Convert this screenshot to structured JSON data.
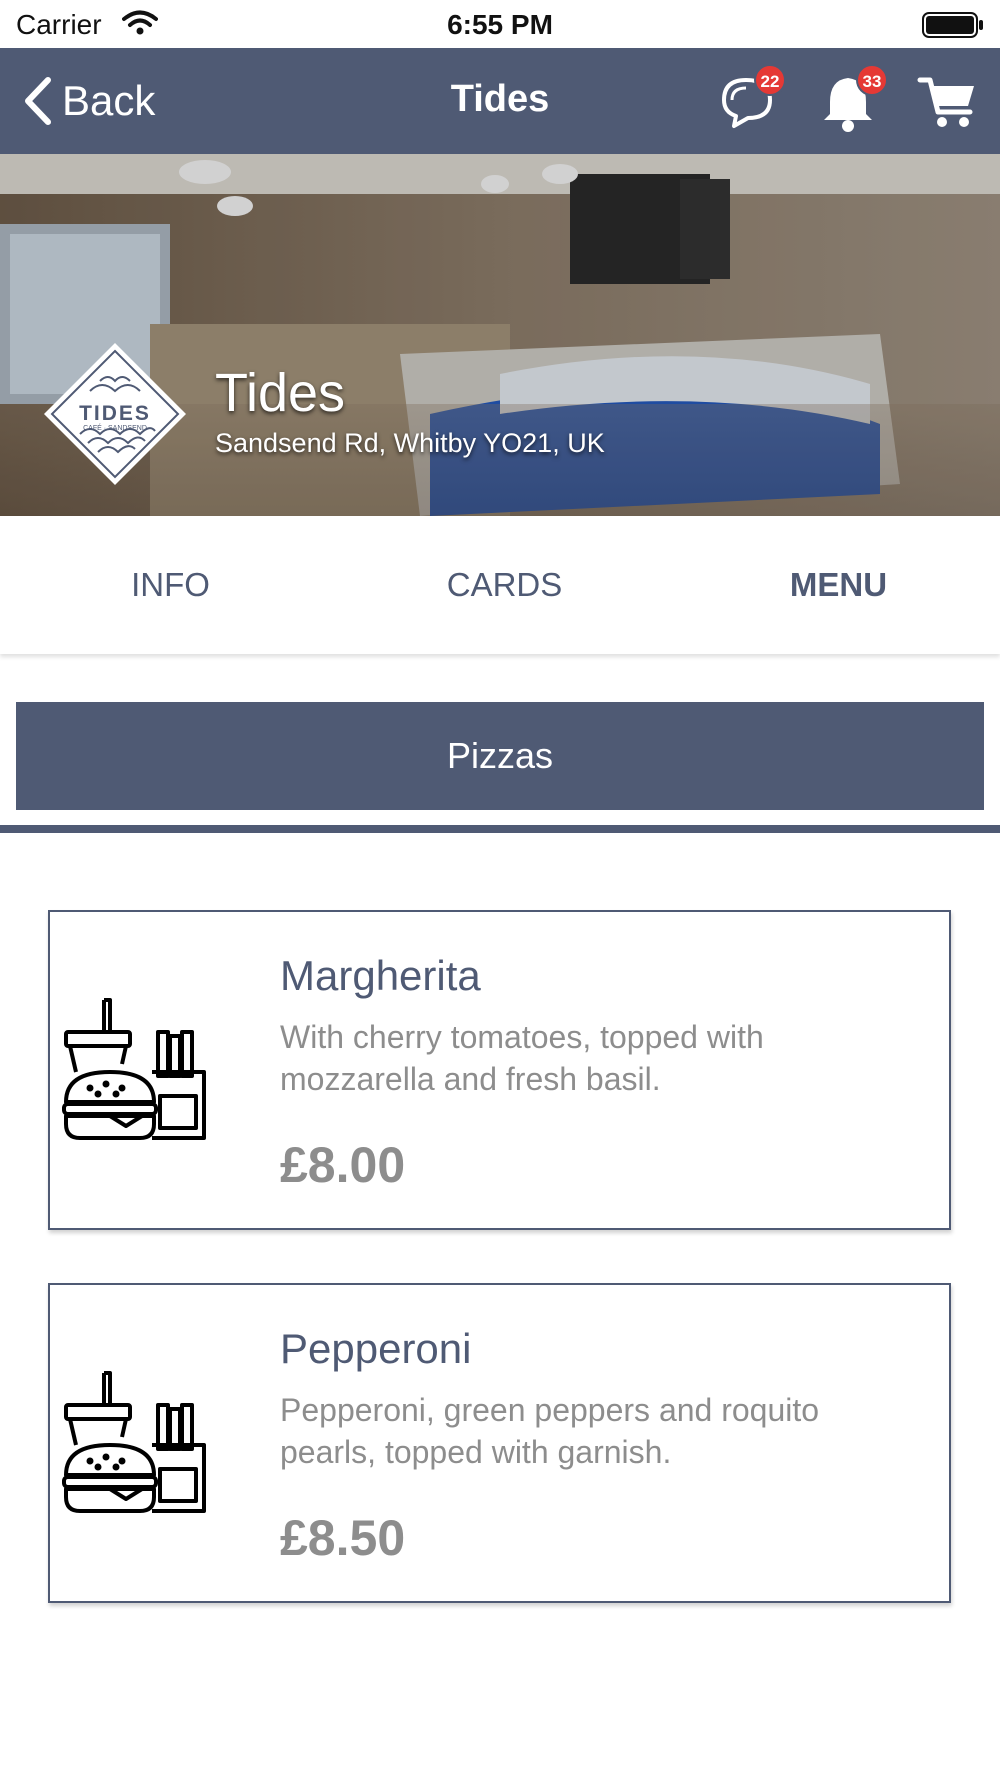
{
  "status_bar": {
    "carrier": "Carrier",
    "time": "6:55 PM"
  },
  "nav": {
    "back_label": "Back",
    "title": "Tides",
    "messages_badge": "22",
    "notifications_badge": "33",
    "icons": [
      "chat-bubbles-icon",
      "bell-icon",
      "cart-icon"
    ]
  },
  "hero": {
    "logo_text": "TIDES",
    "logo_subtext": "CAFÉ · SANDSEND",
    "venue_name": "Tides",
    "address": "Sandsend Rd, Whitby YO21, UK"
  },
  "tabs": [
    {
      "label": "INFO",
      "active": false
    },
    {
      "label": "CARDS",
      "active": false
    },
    {
      "label": "MENU",
      "active": true
    }
  ],
  "category": {
    "label": "Pizzas"
  },
  "menu_items": [
    {
      "name": "Margherita",
      "description": "With cherry tomatoes, topped with mozzarella and fresh basil.",
      "price": "£8.00",
      "icon": "fast-food-icon"
    },
    {
      "name": "Pepperoni",
      "description": "Pepperoni, green peppers and roquito pearls, topped with garnish.",
      "price": "£8.50",
      "icon": "fast-food-icon"
    }
  ],
  "colors": {
    "primary": "#4f5a74",
    "badge": "#e53935",
    "muted_text": "#8d8d8d"
  }
}
